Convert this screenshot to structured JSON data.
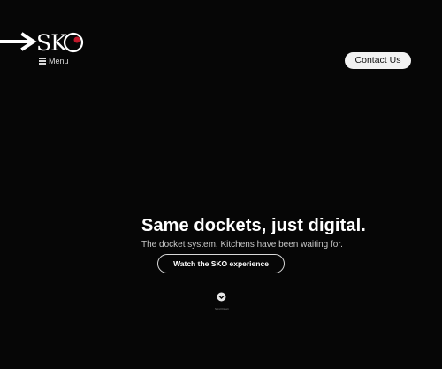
{
  "header": {
    "logo_text": "SKO",
    "menu_label": "Menu",
    "contact_label": "Contact Us"
  },
  "hero": {
    "title": "Same dockets, just digital.",
    "subtitle": "The docket system, Kitchens have been waiting for.",
    "cta_label": "Watch the SKO experience"
  },
  "scroll_hint": {
    "label": "Scroll Down"
  },
  "colors": {
    "background": "#060606",
    "text": "#ffffff",
    "button_bg": "#f2f2f2",
    "logo_accent": "#c0182a"
  },
  "icons": {
    "arrow": "arrow-right-icon",
    "menu": "hamburger-icon",
    "scroll": "chevron-down-circle-icon"
  }
}
